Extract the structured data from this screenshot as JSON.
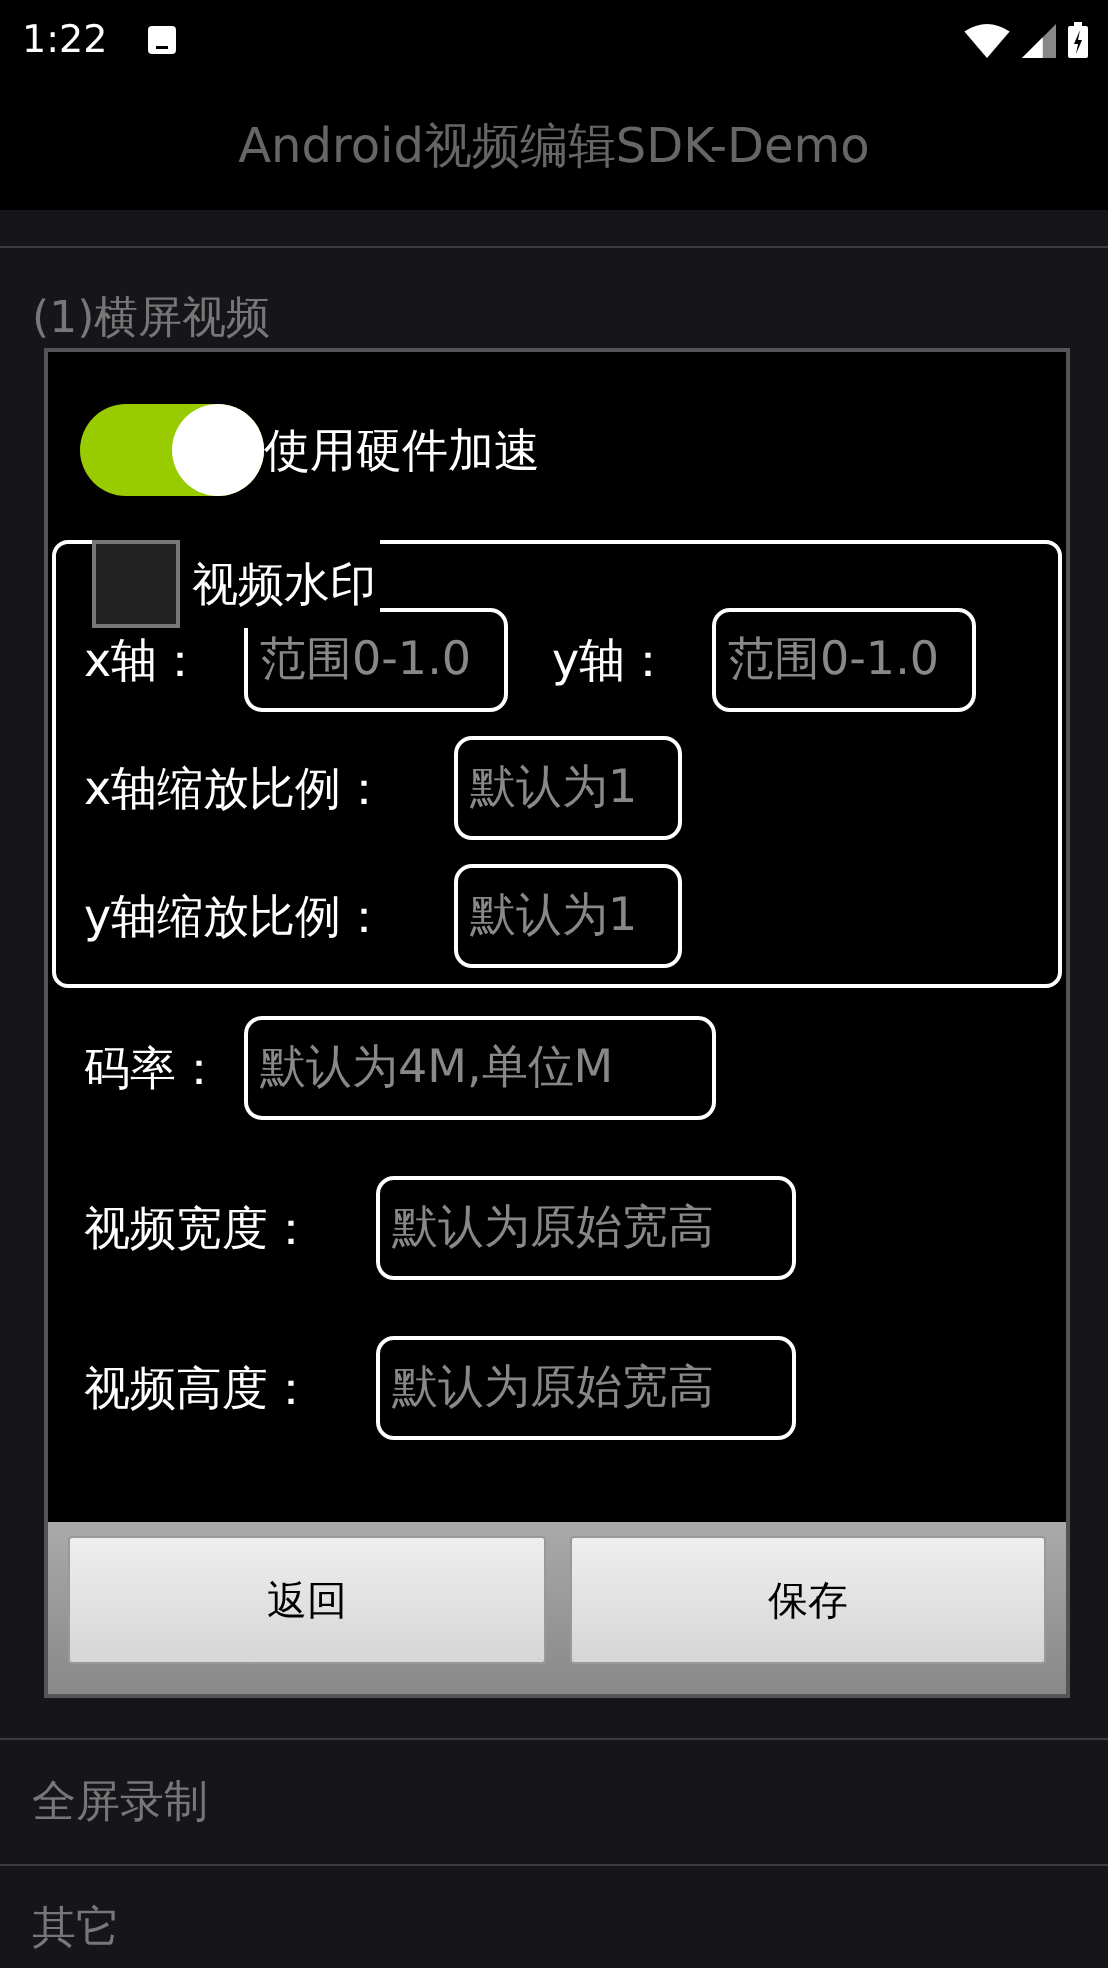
{
  "status_bar": {
    "time": "1:22"
  },
  "app_bar": {
    "title": "Android视频编辑SDK-Demo"
  },
  "background_list": {
    "top_item": "(1)横屏视频",
    "bottom_items": [
      "全屏录制",
      "其它"
    ]
  },
  "dialog": {
    "hardware_acceleration": {
      "label": "使用硬件加速",
      "on": true
    },
    "watermark": {
      "label": "视频水印",
      "checked": false,
      "position": [
        {
          "label": "x轴：",
          "placeholder": "范围0-1.0"
        },
        {
          "label": "y轴：",
          "placeholder": "范围0-1.0"
        }
      ],
      "scale": [
        {
          "label": "x轴缩放比例：",
          "placeholder": "默认为1"
        },
        {
          "label": "y轴缩放比例：",
          "placeholder": "默认为1"
        }
      ]
    },
    "fields": [
      {
        "label": "码率：",
        "placeholder": "默认为4M,单位M"
      },
      {
        "label": "视频宽度：",
        "placeholder": "默认为原始宽高"
      },
      {
        "label": "视频高度：",
        "placeholder": "默认为原始宽高"
      }
    ],
    "buttons": [
      "返回",
      "保存"
    ]
  }
}
